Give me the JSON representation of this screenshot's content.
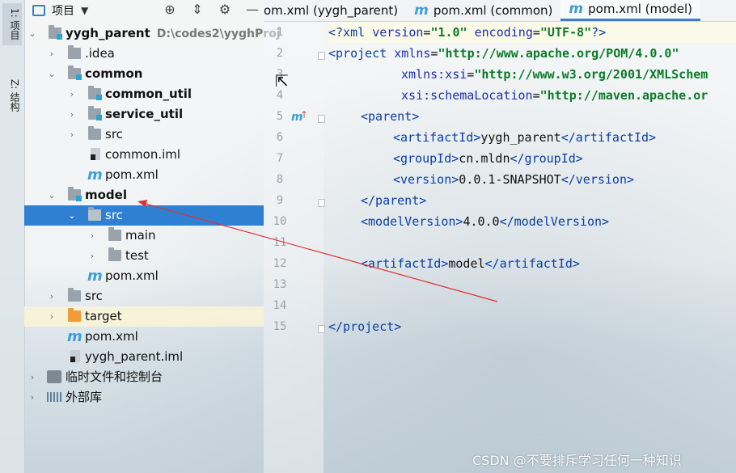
{
  "tool_tabs": [
    {
      "label": "1: 项目"
    },
    {
      "label": "Z: 结构"
    }
  ],
  "panel": {
    "title": "项目",
    "tool_icons": [
      "crosshair-icon",
      "collapse-icon",
      "gear-icon",
      "minimize-icon"
    ]
  },
  "tree": [
    {
      "label": "yygh_parent",
      "hint": "D:\\codes2\\yyghProj"
    },
    {
      "label": ".idea"
    },
    {
      "label": "common"
    },
    {
      "label": "common_util"
    },
    {
      "label": "service_util"
    },
    {
      "label": "src"
    },
    {
      "label": "common.iml"
    },
    {
      "label": "pom.xml"
    },
    {
      "label": "model"
    },
    {
      "label": "src"
    },
    {
      "label": "main"
    },
    {
      "label": "test"
    },
    {
      "label": "pom.xml"
    },
    {
      "label": "src"
    },
    {
      "label": "target"
    },
    {
      "label": "pom.xml"
    },
    {
      "label": "yygh_parent.iml"
    },
    {
      "label": "临时文件和控制台"
    },
    {
      "label": "外部库"
    }
  ],
  "tabs": [
    {
      "label": "om.xml (yygh_parent)"
    },
    {
      "label": "pom.xml (common)"
    },
    {
      "label": "pom.xml (model)"
    }
  ],
  "line_numbers": [
    "1",
    "2",
    "3",
    "4",
    "5",
    "6",
    "7",
    "8",
    "9",
    "10",
    "11",
    "12",
    "13",
    "14",
    "15"
  ],
  "code": {
    "l1": {
      "a": "<?xml ",
      "b": "version",
      "c": "=",
      "d": "\"1.0\"",
      "e": " ",
      "f": "encoding",
      "g": "=",
      "h": "\"UTF-8\"",
      "i": "?>"
    },
    "l2": {
      "a": "<project ",
      "b": "xmlns",
      "c": "=",
      "d": "\"http://www.apache.org/POM/4.0.0\""
    },
    "l3": {
      "a": "xmlns:xsi",
      "b": "=",
      "c": "\"http://www.w3.org/2001/XMLSchem"
    },
    "l4": {
      "a": "xsi:schemaLocation",
      "b": "=",
      "c": "\"http://maven.apache.or"
    },
    "l5": {
      "a": "<parent>"
    },
    "l6": {
      "a": "<artifactId>",
      "b": "yygh_parent",
      "c": "</artifactId>"
    },
    "l7": {
      "a": "<groupId>",
      "b": "cn.mldn",
      "c": "</groupId>"
    },
    "l8": {
      "a": "<version>",
      "b": "0.0.1-SNAPSHOT",
      "c": "</version>"
    },
    "l9": {
      "a": "</parent>"
    },
    "l10": {
      "a": "<modelVersion>",
      "b": "4.0.0",
      "c": "</modelVersion>"
    },
    "l12": {
      "a": "<artifactId>",
      "b": "model",
      "c": "</artifactId>"
    },
    "l15": {
      "a": "</project>"
    }
  },
  "watermark": "CSDN @不要排斥学习任何一种知识",
  "colors": {
    "accent": "#2f7fd3",
    "arrow": "#e03030"
  }
}
